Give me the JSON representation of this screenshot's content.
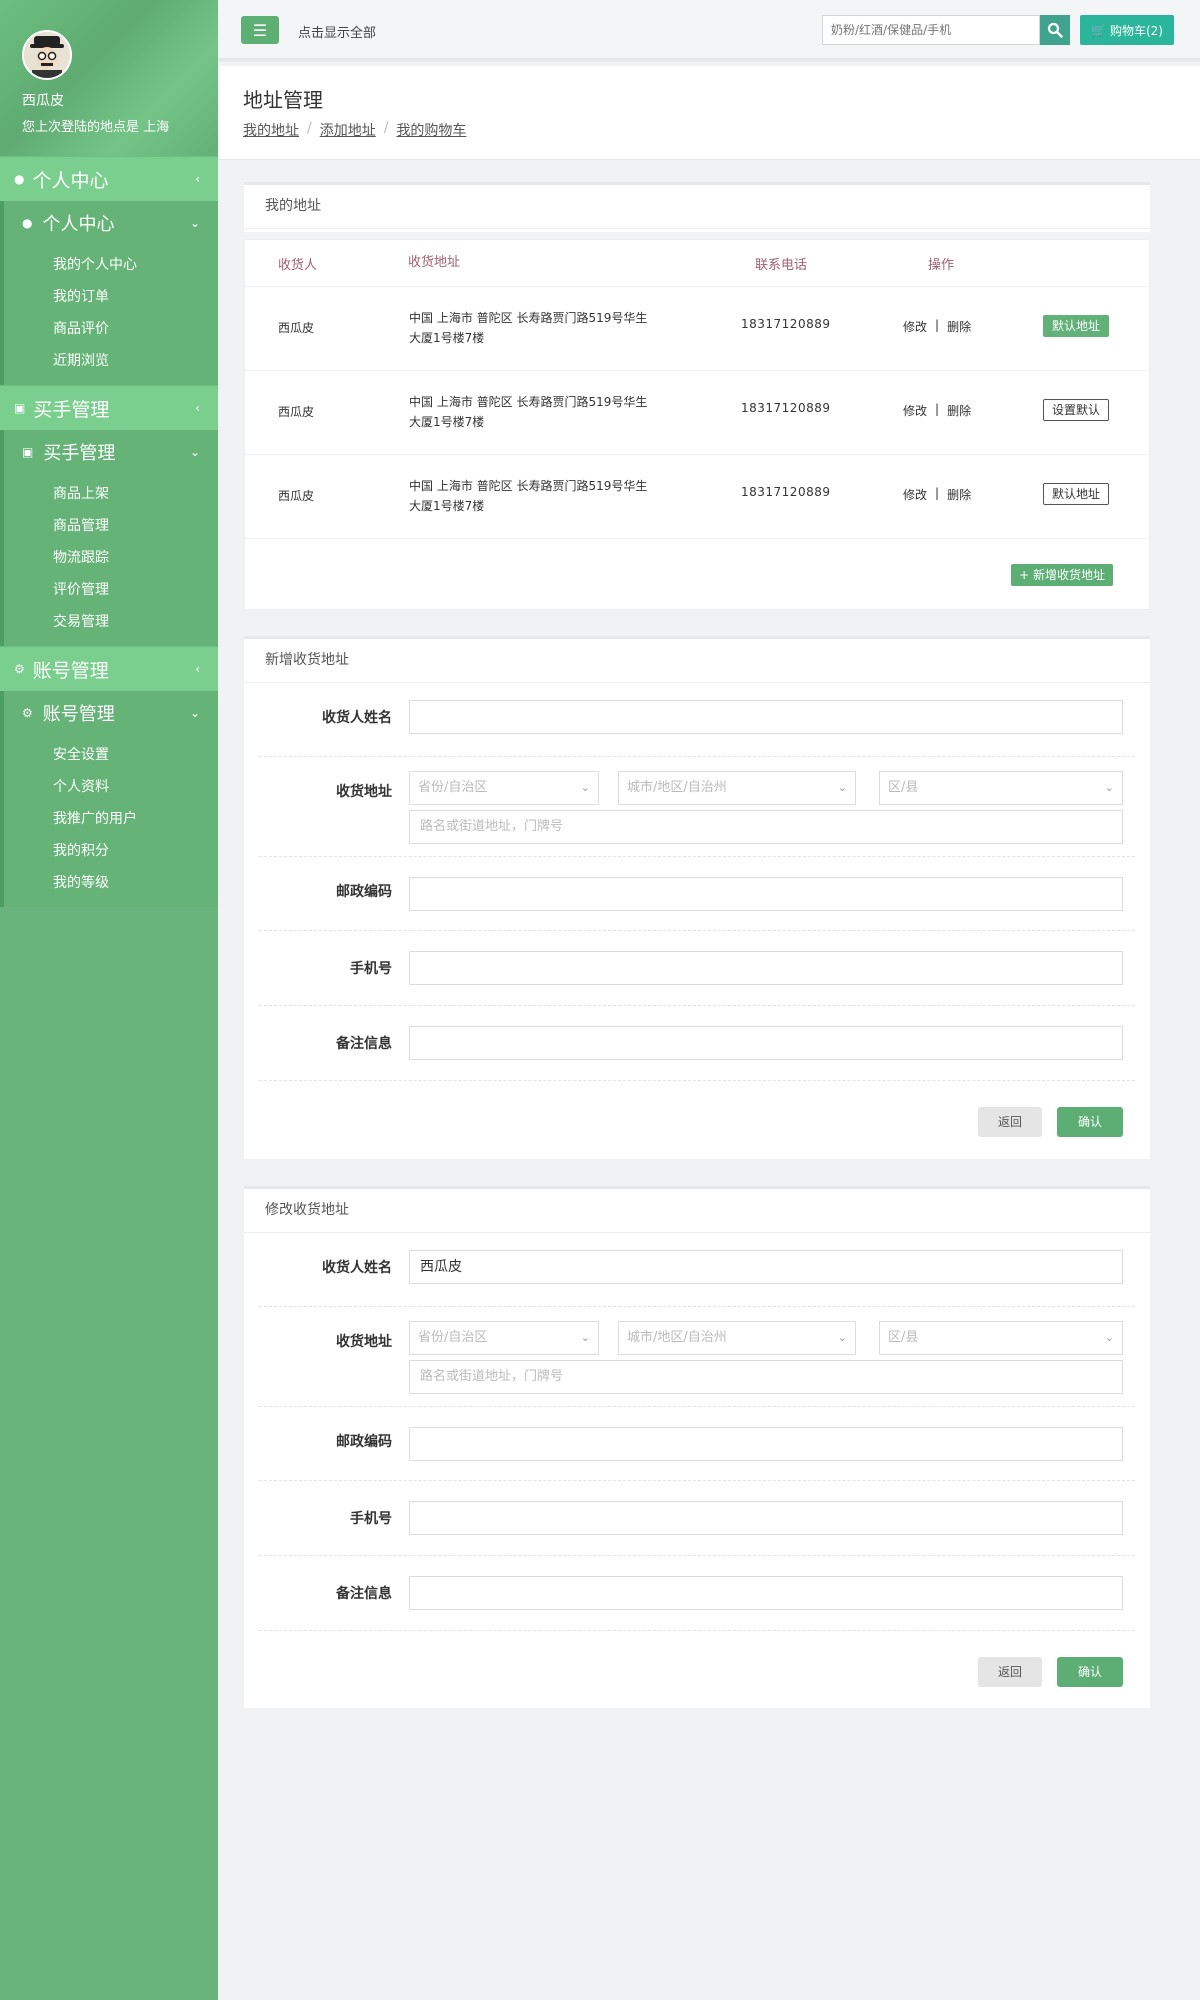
{
  "user": {
    "name": "西瓜皮",
    "last_login": "您上次登陆的地点是 上海"
  },
  "sidebar": {
    "sections": [
      {
        "head": "个人中心",
        "sub": "个人中心",
        "items": [
          "我的个人中心",
          "我的订单",
          "商品评价",
          "近期浏览"
        ]
      },
      {
        "head": "买手管理",
        "sub": "买手管理",
        "items": [
          "商品上架",
          "商品管理",
          "物流跟踪",
          "评价管理",
          "交易管理"
        ]
      },
      {
        "head": "账号管理",
        "sub": "账号管理",
        "items": [
          "安全设置",
          "个人资料",
          "我推广的用户",
          "我的积分",
          "我的等级"
        ]
      }
    ]
  },
  "topbar": {
    "show_all": "点击显示全部",
    "search_placeholder": "奶粉/红酒/保健品/手机",
    "cart_label": "购物车(2)"
  },
  "page": {
    "title": "地址管理",
    "breadcrumb": [
      "我的地址",
      "添加地址",
      "我的购物车"
    ]
  },
  "my_address": {
    "title": "我的地址",
    "columns": [
      "收货人",
      "收货地址",
      "联系电话",
      "操作"
    ],
    "rows": [
      {
        "name": "西瓜皮",
        "address_line1": "中国 上海市 普陀区 长寿路贾门路519号华生",
        "address_line2": "大厦1号楼7楼",
        "phone": "18317120889",
        "edit": "修改",
        "sep": "|",
        "delete": "删除",
        "action": "默认地址"
      },
      {
        "name": "西瓜皮",
        "address_line1": "中国 上海市 普陀区 长寿路贾门路519号华生",
        "address_line2": "大厦1号楼7楼",
        "phone": "18317120889",
        "edit": "修改",
        "sep": "|",
        "delete": "删除",
        "action": "设置默认"
      },
      {
        "name": "西瓜皮",
        "address_line1": "中国 上海市 普陀区 长寿路贾门路519号华生",
        "address_line2": "大厦1号楼7楼",
        "phone": "18317120889",
        "edit": "修改",
        "sep": "|",
        "delete": "删除",
        "action": "默认地址"
      }
    ],
    "add_button": "+ 新增收货地址"
  },
  "new_form": {
    "title": "新增收货地址",
    "labels": {
      "name": "收货人姓名",
      "address": "收货地址",
      "zip": "邮政编码",
      "phone": "手机号",
      "note": "备注信息"
    },
    "values": {
      "name": ""
    },
    "select_province": "省份/自治区",
    "select_city": "城市/地区/自治州",
    "select_district": "区/县",
    "street_placeholder": "路名或街道地址，门牌号",
    "back": "返回",
    "confirm": "确认"
  },
  "edit_form": {
    "title": "修改收货地址",
    "labels": {
      "name": "收货人姓名",
      "address": "收货地址",
      "zip": "邮政编码",
      "phone": "手机号",
      "note": "备注信息"
    },
    "values": {
      "name": "西瓜皮"
    },
    "select_province": "省份/自治区",
    "select_city": "城市/地区/自治州",
    "select_district": "区/县",
    "street_placeholder": "路名或街道地址，门牌号",
    "back": "返回",
    "confirm": "确认"
  }
}
